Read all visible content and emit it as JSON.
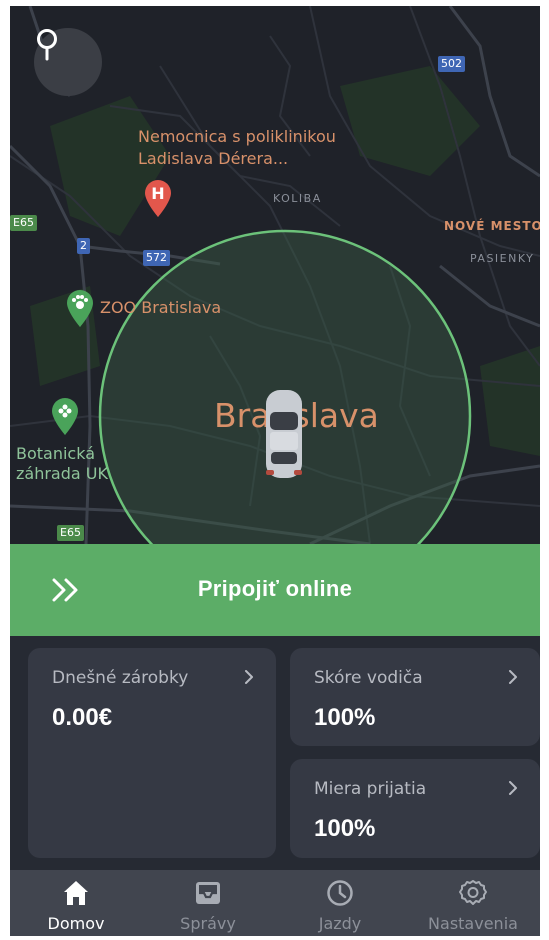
{
  "map": {
    "hospital_label_line1": "Nemocnica s poliklinikou",
    "hospital_label_line2": "Ladislava Dérera...",
    "hospital_marker": "H",
    "district_koliba": "KOLIBA",
    "district_nove_mesto": "NOVÉ MESTO",
    "district_pasienky": "PASIENKY",
    "zoo_label": "ZOO Bratislava",
    "city_label": "Bratislava",
    "garden_label_line1": "Botanická",
    "garden_label_line2": "záhrada UK",
    "road_shields": {
      "e65_top": "E65",
      "r2": "2",
      "r572": "572",
      "r502": "502",
      "e65_bottom": "E65"
    },
    "pin_button_icon": "map-pin-icon",
    "coverage_color": "#5cad67"
  },
  "online": {
    "label": "Pripojiť online",
    "icon": "double-chevron-right-icon",
    "color": "#5cad67"
  },
  "cards": {
    "earnings": {
      "title": "Dnešné zárobky",
      "value": "0.00€"
    },
    "driver_score": {
      "title": "Skóre vodiča",
      "value": "100%"
    },
    "acceptance": {
      "title": "Miera prijatia",
      "value": "100%"
    }
  },
  "nav": {
    "items": [
      {
        "label": "Domov",
        "icon": "home-icon",
        "active": true
      },
      {
        "label": "Správy",
        "icon": "inbox-icon",
        "active": false
      },
      {
        "label": "Jazdy",
        "icon": "clock-icon",
        "active": false
      },
      {
        "label": "Nastavenia",
        "icon": "gear-icon",
        "active": false
      }
    ]
  }
}
